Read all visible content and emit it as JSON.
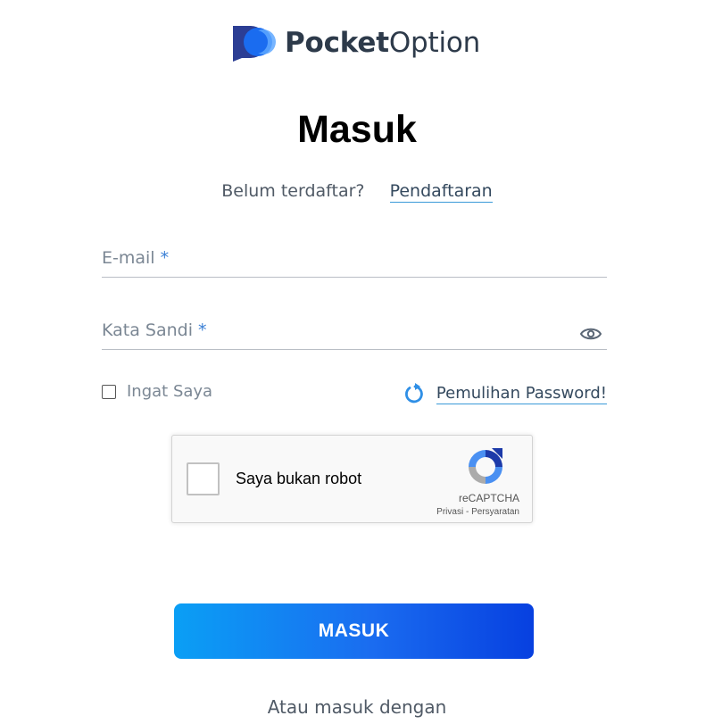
{
  "brand": {
    "name_bold": "Pocket",
    "name_regular": "Option",
    "logo_blue": "#1a6cf0",
    "logo_navy": "#2c3e94",
    "logo_light": "#5fa8ff"
  },
  "page": {
    "title": "Masuk"
  },
  "signup": {
    "question": "Belum terdaftar?",
    "link": "Pendaftaran"
  },
  "form": {
    "email": {
      "label": "E-mail",
      "required_mark": "*",
      "value": ""
    },
    "password": {
      "label": "Kata Sandi",
      "required_mark": "*",
      "value": "",
      "toggle_icon": "eye-icon"
    },
    "remember": {
      "label": "Ingat Saya",
      "checked": false
    },
    "recover": {
      "label": "Pemulihan Password!",
      "icon": "refresh-icon"
    }
  },
  "captcha": {
    "label": "Saya bukan robot",
    "brand": "reCAPTCHA",
    "privacy": "Privasi",
    "separator": "-",
    "terms": "Persyaratan",
    "checked": false
  },
  "submit": {
    "label": "MASUK"
  },
  "alt_login": {
    "text": "Atau masuk dengan"
  },
  "colors": {
    "accent": "#3a9ad9",
    "button_start": "#0a9ff5",
    "button_end": "#0740e0",
    "text": "#34495e"
  }
}
